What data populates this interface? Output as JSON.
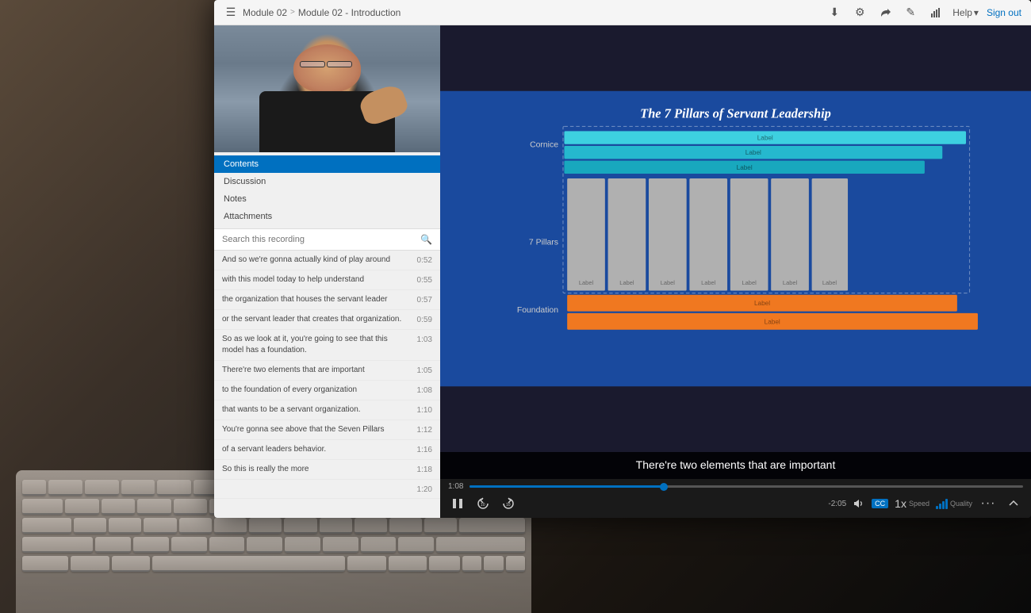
{
  "toolbar": {
    "breadcrumb": {
      "module": "Module 02",
      "separator": ">",
      "page": "Module 02 - Introduction"
    },
    "actions": {
      "download": "⬇",
      "settings": "⚙",
      "share": "⬆",
      "edit": "✎",
      "stats": "📊",
      "help": "Help",
      "help_arrow": "▾",
      "sign_out": "Sign out"
    }
  },
  "sidebar": {
    "nav_items": [
      {
        "label": "Contents",
        "active": true
      },
      {
        "label": "Discussion",
        "active": false
      },
      {
        "label": "Notes",
        "active": false
      },
      {
        "label": "Attachments",
        "active": false
      }
    ],
    "search": {
      "placeholder": "Search this recording"
    },
    "transcript": [
      {
        "text": "And so we're gonna actually kind of play around",
        "time": "0:52"
      },
      {
        "text": "with this model today to help understand",
        "time": "0:55"
      },
      {
        "text": "the organization that houses the servant leader",
        "time": "0:57"
      },
      {
        "text": "or the servant leader that creates that organization.",
        "time": "0:59"
      },
      {
        "text": "So as we look at it, you're going to see that this model has a foundation.",
        "time": "1:03"
      },
      {
        "text": "There're two elements that are important",
        "time": "1:05"
      },
      {
        "text": "to the foundation of every organization",
        "time": "1:08"
      },
      {
        "text": "that wants to be a servant organization.",
        "time": "1:10"
      },
      {
        "text": "You're gonna see above that the Seven Pillars",
        "time": "1:12"
      },
      {
        "text": "of a servant leaders behavior.",
        "time": "1:16"
      },
      {
        "text": "So this is really the more",
        "time": "1:18"
      },
      {
        "text": "",
        "time": "1:20"
      }
    ]
  },
  "slide": {
    "title": "The 7 Pillars of Servant Leadership",
    "cornice_label": "Cornice",
    "pillars_label": "7 Pillars",
    "foundation_label": "Foundation",
    "cornice_bars": [
      "Label",
      "Label",
      "Label"
    ],
    "pillar_labels": [
      "Label",
      "Label",
      "Label",
      "Label",
      "Label",
      "Label",
      "Label"
    ],
    "foundation_bars": [
      "Label",
      "Label"
    ],
    "cornice_colors": [
      "#3fc0d0",
      "#2ab0c8",
      "#1aa0b8"
    ]
  },
  "video": {
    "caption": "There're two elements that are important",
    "current_time": "1:08",
    "remaining_time": "-2:05",
    "progress_percent": 35,
    "speed_label": "Speed",
    "speed_value": "1x",
    "quality_label": "Quality",
    "controls": {
      "play_pause": "⏸",
      "rewind": "↺",
      "forward": "↷",
      "volume": "🔊",
      "cc": "CC",
      "more": "···",
      "expand": "⌃"
    }
  }
}
